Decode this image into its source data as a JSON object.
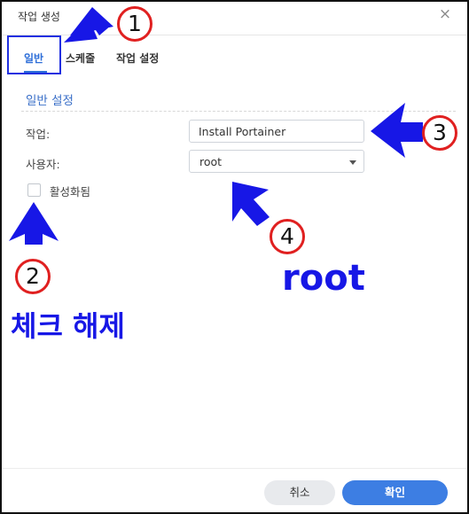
{
  "dialog": {
    "title": "작업 생성",
    "close_symbol": "×"
  },
  "tabs": [
    {
      "label": "일반",
      "active": true
    },
    {
      "label": "스케줄",
      "active": false
    },
    {
      "label": "작업 설정",
      "active": false
    }
  ],
  "general": {
    "section_title": "일반 설정",
    "task_label": "작업:",
    "task_value": "Install Portainer",
    "user_label": "사용자:",
    "user_value": "root",
    "enabled_label": "활성화됨",
    "enabled_checked": false
  },
  "annotations": {
    "markers": [
      "1",
      "2",
      "3",
      "4"
    ],
    "uncheck_text": "체크 해제",
    "root_text": "root",
    "arrow_color": "#1717e6",
    "marker_ring_color": "#e02020"
  },
  "footer": {
    "cancel_label": "취소",
    "ok_label": "확인"
  },
  "colors": {
    "accent": "#3d7ee3",
    "section_title": "#3a6fc8"
  }
}
